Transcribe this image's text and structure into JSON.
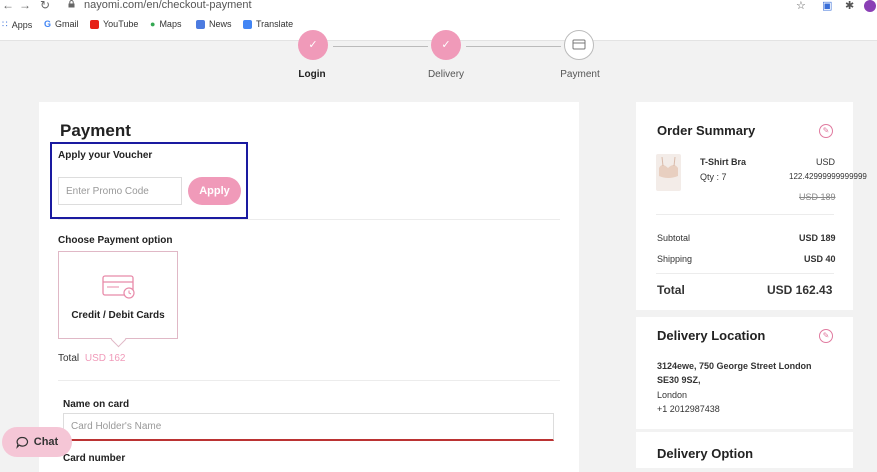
{
  "browser": {
    "url": "nayomi.com/en/checkout-payment",
    "bookmarks": [
      {
        "label": "Apps",
        "icon": "apps-grid-icon"
      },
      {
        "label": "Gmail",
        "icon": "google-icon"
      },
      {
        "label": "YouTube",
        "icon": "youtube-icon"
      },
      {
        "label": "Maps",
        "icon": "maps-pin-icon"
      },
      {
        "label": "News",
        "icon": "news-icon"
      },
      {
        "label": "Translate",
        "icon": "translate-icon"
      }
    ]
  },
  "stepper": {
    "steps": [
      {
        "label": "Login",
        "status": "done"
      },
      {
        "label": "Delivery",
        "status": "done"
      },
      {
        "label": "Payment",
        "status": "current"
      }
    ]
  },
  "payment": {
    "title": "Payment",
    "voucher_label": "Apply your Voucher",
    "promo_placeholder": "Enter Promo Code",
    "apply_label": "Apply",
    "choose_label": "Choose Payment option",
    "card_option_label": "Credit / Debit Cards",
    "total_label": "Total",
    "total_amount": "USD 162",
    "name_label": "Name on card",
    "name_placeholder": "Card Holder's Name",
    "card_number_label": "Card number"
  },
  "order_summary": {
    "title": "Order Summary",
    "product_name": "T-Shirt Bra",
    "product_qty": "Qty : 7",
    "product_currency": "USD",
    "product_price": "122.42999999999999",
    "product_old_price": "USD 189",
    "subtotal_label": "Subtotal",
    "subtotal_value": "USD 189",
    "shipping_label": "Shipping",
    "shipping_value": "USD 40",
    "total_label": "Total",
    "total_value": "USD 162.43"
  },
  "delivery_location": {
    "title": "Delivery Location",
    "address_line1": "3124ewe, 750 George Street London",
    "address_line2": "SE30 9SZ,",
    "city": "London",
    "phone": "+1 2012987438"
  },
  "delivery_option": {
    "title": "Delivery Option"
  },
  "chat": {
    "label": "Chat"
  },
  "colors": {
    "accent": "#f09ab9",
    "highlight_border": "#1a1aa0"
  }
}
